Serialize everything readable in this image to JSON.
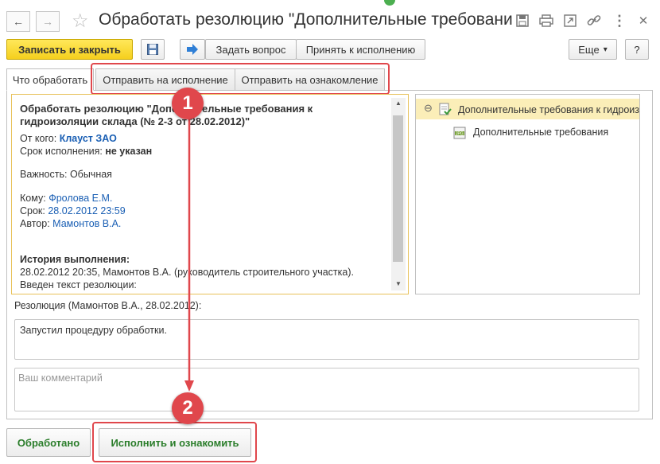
{
  "window": {
    "title": "Обработать резолюцию \"Дополнительные требования к..."
  },
  "toolbar": {
    "save_close": "Записать и закрыть",
    "ask": "Задать вопрос",
    "accept": "Принять к исполнению",
    "more": "Еще",
    "more_arrow": "▾",
    "help": "?"
  },
  "tabs": [
    {
      "label": "Что обработать",
      "active": true
    },
    {
      "label": "Отправить на исполнение",
      "active": false
    },
    {
      "label": "Отправить на ознакомление",
      "active": false
    }
  ],
  "task": {
    "title_line1": "Обработать резолюцию \"Дополнительные требования к",
    "title_line2": "гидроизоляции склада (№ 2-3 от 28.02.2012)\"",
    "from_label": "От кого:",
    "from_value": "Клауст ЗАО",
    "deadline_label": "Срок исполнения:",
    "deadline_value": "не указан",
    "importance": "Важность: Обычная",
    "to_label": "Кому:",
    "to_value": "Фролова Е.М.",
    "due_label": "Срок:",
    "due_value": "28.02.2012 23:59",
    "author_label": "Автор:",
    "author_value": "Мамонтов В.А.",
    "history_title": "История выполнения:",
    "history_line1": "28.02.2012 20:35, Мамонтов В.А. (руководитель строительного участка).",
    "history_line2": "Введен текст резолюции:"
  },
  "tree": {
    "root": "Дополнительные требования к гидроизоляции",
    "child": "Дополнительные требования",
    "collapse": "⊖"
  },
  "resolution": {
    "label": "Резолюция (Мамонтов В.А., 28.02.2012):",
    "text": "Запустил процедуру обработки."
  },
  "comment": {
    "placeholder": "Ваш комментарий"
  },
  "bottom": {
    "done": "Обработано",
    "execute": "Исполнить и ознакомить"
  },
  "annotations": {
    "badge1": "1",
    "badge2": "2",
    "color": "#e0474c"
  },
  "icons": {
    "back": "←",
    "forward": "→",
    "star": "☆",
    "save": "💾",
    "print": "🖶",
    "link": "🔗",
    "more": "⋮",
    "close": "✕"
  }
}
